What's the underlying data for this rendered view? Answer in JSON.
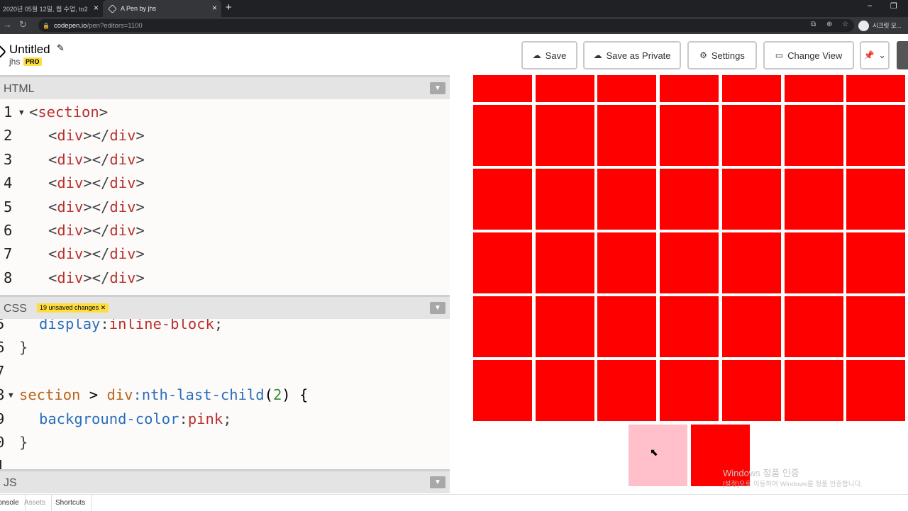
{
  "browser": {
    "tabs": [
      {
        "title": "2020년 05월 12일, 웹 수업, to2"
      },
      {
        "title": "A Pen by jhs"
      }
    ],
    "url_host": "codepen.io",
    "url_path": "/pen?editors=1100",
    "profile_label": "시크릿 모..."
  },
  "header": {
    "title": "Untitled",
    "author": "jhs",
    "pro_badge": "PRO",
    "buttons": {
      "save": "Save",
      "save_private": "Save as Private",
      "settings": "Settings",
      "change_view": "Change View"
    }
  },
  "editors": {
    "html_label": "HTML",
    "css_label": "CSS",
    "css_unsaved": "19 unsaved changes",
    "js_label": "JS",
    "html_code": [
      {
        "n": "1",
        "text": "<section>"
      },
      {
        "n": "2",
        "text": "<div></div>"
      },
      {
        "n": "3",
        "text": "<div></div>"
      },
      {
        "n": "4",
        "text": "<div></div>"
      },
      {
        "n": "5",
        "text": "<div></div>"
      },
      {
        "n": "6",
        "text": "<div></div>"
      },
      {
        "n": "7",
        "text": "<div></div>"
      },
      {
        "n": "8",
        "text": "<div></div>"
      }
    ],
    "css_code": [
      {
        "n": "5",
        "text": "display:inline-block;"
      },
      {
        "n": "6",
        "text": "}"
      },
      {
        "n": "7",
        "text": ""
      },
      {
        "n": "8",
        "text": "section > div:nth-last-child(2) {"
      },
      {
        "n": "9",
        "text": "background-color:pink;"
      },
      {
        "n": "0",
        "text": "}"
      },
      {
        "n": "1",
        "text": ""
      }
    ]
  },
  "preview": {
    "grid_color": "#ff0000",
    "highlight_color": "#ffc0cb",
    "rows": 6,
    "cols": 7,
    "last_row_count": 2
  },
  "watermark": {
    "line1": "Windows 정품 인증",
    "line2": "[설정]으로 이동하여 Windows를 정품 인증합니다."
  },
  "footer": {
    "console": "Console",
    "assets": "Assets",
    "shortcuts": "Shortcuts"
  }
}
